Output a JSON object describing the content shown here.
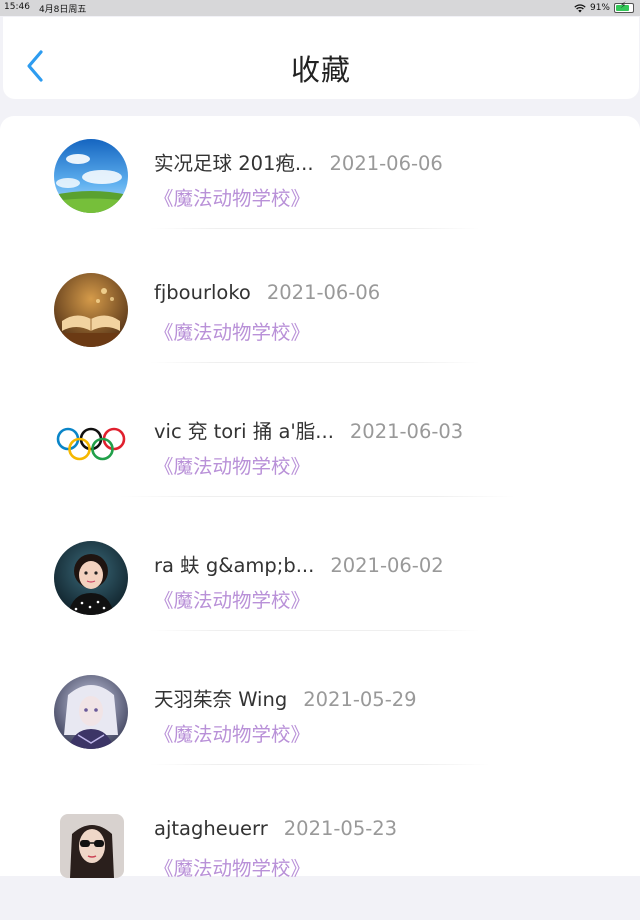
{
  "status": {
    "time": "15:46",
    "date": "4月8日周五",
    "battery": "91%",
    "battery_level": 0.91
  },
  "nav": {
    "title": "收藏",
    "back_icon": "chevron-left-icon",
    "accent": "#2d9cf0"
  },
  "favorites": [
    {
      "name": "实况足球 201疱...",
      "date": "2021-06-06",
      "book": "《魔法动物学校》",
      "avatar": "sky-landscape"
    },
    {
      "name": "fjbourloko",
      "date": "2021-06-06",
      "book": "《魔法动物学校》",
      "avatar": "open-book"
    },
    {
      "name": "vic 兗 tori 捅 a'脂...",
      "date": "2021-06-03",
      "book": "《魔法动物学校》",
      "avatar": "olympic-rings"
    },
    {
      "name": "ra 蚨 g&amp;b...",
      "date": "2021-06-02",
      "book": "《魔法动物学校》",
      "avatar": "child-photo"
    },
    {
      "name": "天羽茱奈 Wing",
      "date": "2021-05-29",
      "book": "《魔法动物学校》",
      "avatar": "anime-girl"
    },
    {
      "name": "ajtagheuerr",
      "date": "2021-05-23",
      "book": "《魔法动物学校》",
      "avatar": "woman-sunglasses"
    }
  ],
  "colors": {
    "book_title": "#b991d8",
    "date": "#999999",
    "name": "#333333"
  }
}
